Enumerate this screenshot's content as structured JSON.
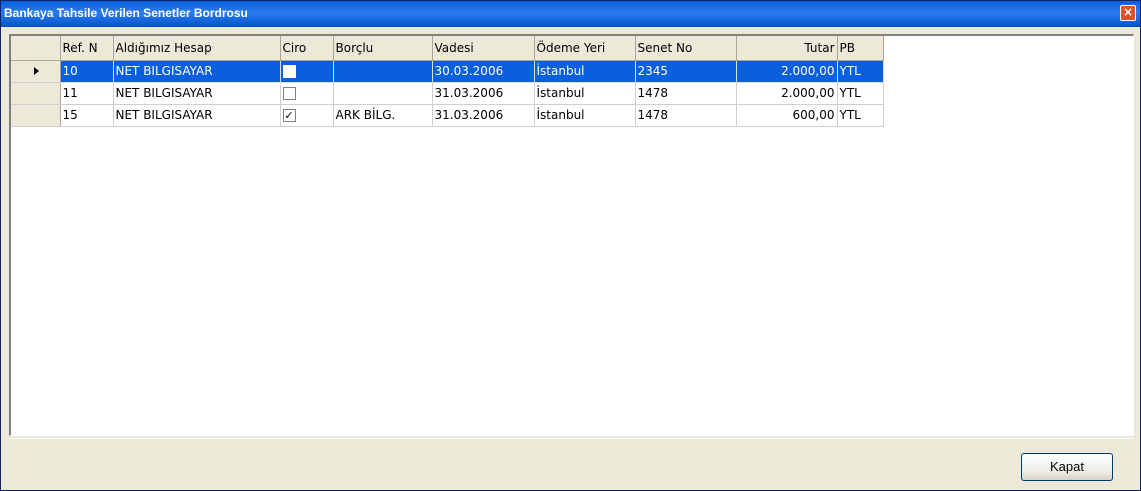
{
  "window": {
    "title": "Bankaya Tahsile Verilen Senetler Bordrosu",
    "close_glyph": "×"
  },
  "grid": {
    "columns": [
      "Ref. N",
      "Aldığımız Hesap",
      "Ciro",
      "Borçlu",
      "Vadesi",
      "Ödeme Yeri",
      "Senet No",
      "Tutar",
      "PB"
    ],
    "rows": [
      {
        "ref": "10",
        "hesap": "NET BILGISAYAR",
        "ciro": "",
        "borclu": "",
        "vade": "30.03.2006",
        "odeme": "İstanbul",
        "senet": "2345",
        "tutar": "2.000,00",
        "pb": "YTL"
      },
      {
        "ref": "11",
        "hesap": "NET BILGISAYAR",
        "ciro": "",
        "borclu": "",
        "vade": "31.03.2006",
        "odeme": "İstanbul",
        "senet": "1478",
        "tutar": "2.000,00",
        "pb": "YTL"
      },
      {
        "ref": "15",
        "hesap": "NET BILGISAYAR",
        "ciro": "✓",
        "borclu": "ARK BİLG.",
        "vade": "31.03.2006",
        "odeme": "İstanbul",
        "senet": "1478",
        "tutar": "600,00",
        "pb": "YTL"
      }
    ]
  },
  "footer": {
    "close_label": "Kapat"
  }
}
